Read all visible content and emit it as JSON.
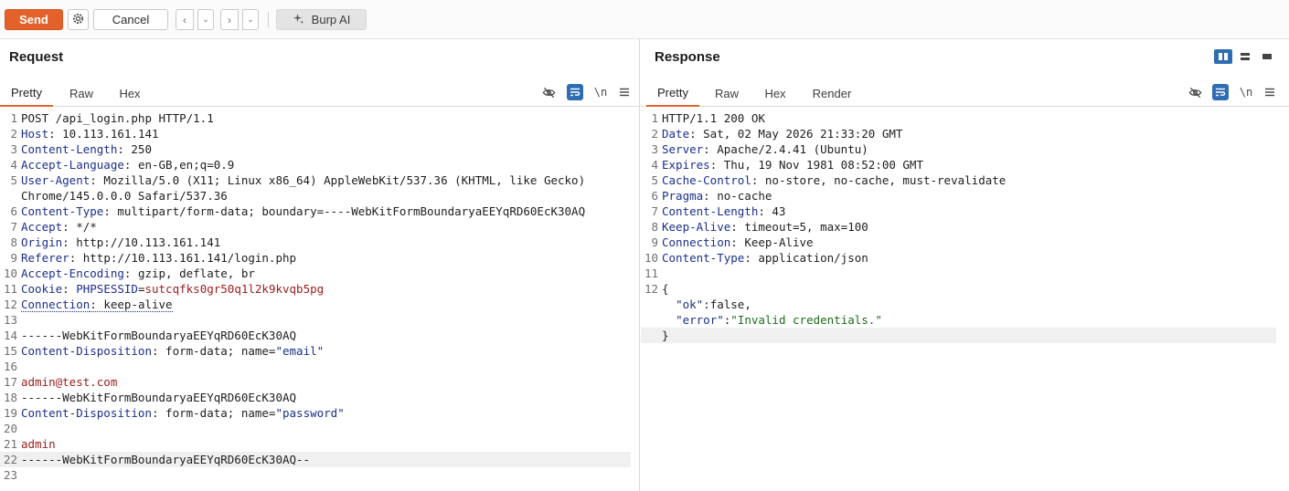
{
  "toolbar": {
    "send_label": "Send",
    "cancel_label": "Cancel",
    "burp_ai_label": "Burp AI",
    "back_glyph": "‹",
    "forward_glyph": "›",
    "dropdown_glyph": "⌄"
  },
  "request": {
    "title": "Request",
    "tabs": [
      "Pretty",
      "Raw",
      "Hex"
    ],
    "active_tab": "Pretty",
    "newline_label": "\\n",
    "lines": [
      {
        "n": "1",
        "parts": [
          {
            "t": "POST /api_login.php HTTP/1.1",
            "c": "hv"
          }
        ]
      },
      {
        "n": "2",
        "parts": [
          {
            "t": "Host",
            "c": "hk"
          },
          {
            "t": ": 10.113.161.141",
            "c": "hv"
          }
        ]
      },
      {
        "n": "3",
        "parts": [
          {
            "t": "Content-Length",
            "c": "hk"
          },
          {
            "t": ": 250",
            "c": "hv"
          }
        ]
      },
      {
        "n": "4",
        "parts": [
          {
            "t": "Accept-Language",
            "c": "hk"
          },
          {
            "t": ": en-GB,en;q=0.9",
            "c": "hv"
          }
        ]
      },
      {
        "n": "5",
        "parts": [
          {
            "t": "User-Agent",
            "c": "hk"
          },
          {
            "t": ": Mozilla/5.0 (X11; Linux x86_64) AppleWebKit/537.36 (KHTML, like Gecko)",
            "c": "hv"
          }
        ]
      },
      {
        "n": "",
        "parts": [
          {
            "t": "Chrome/145.0.0.0 Safari/537.36",
            "c": "hv"
          }
        ]
      },
      {
        "n": "6",
        "parts": [
          {
            "t": "Content-Type",
            "c": "hk"
          },
          {
            "t": ": multipart/form-data; boundary=----WebKitFormBoundaryaEEYqRD60EcK30AQ",
            "c": "hv"
          }
        ]
      },
      {
        "n": "7",
        "parts": [
          {
            "t": "Accept",
            "c": "hk"
          },
          {
            "t": ": */*",
            "c": "hv"
          }
        ]
      },
      {
        "n": "8",
        "parts": [
          {
            "t": "Origin",
            "c": "hk"
          },
          {
            "t": ": http://10.113.161.141",
            "c": "hv"
          }
        ]
      },
      {
        "n": "9",
        "parts": [
          {
            "t": "Referer",
            "c": "hk"
          },
          {
            "t": ": http://10.113.161.141/login.php",
            "c": "hv"
          }
        ]
      },
      {
        "n": "10",
        "parts": [
          {
            "t": "Accept-Encoding",
            "c": "hk"
          },
          {
            "t": ": gzip, deflate, br",
            "c": "hv"
          }
        ]
      },
      {
        "n": "11",
        "parts": [
          {
            "t": "Cookie",
            "c": "hk"
          },
          {
            "t": ": ",
            "c": "hv"
          },
          {
            "t": "PHPSESSID",
            "c": "hk"
          },
          {
            "t": "=",
            "c": "hv"
          },
          {
            "t": "sutcqfks0gr50q1l2k9kvqb5pg",
            "c": "red"
          }
        ]
      },
      {
        "n": "12",
        "parts": [
          {
            "t": "Connection",
            "c": "hk dotted"
          },
          {
            "t": ": keep-alive",
            "c": "hv dotted"
          }
        ]
      },
      {
        "n": "13",
        "parts": []
      },
      {
        "n": "14",
        "parts": [
          {
            "t": "------WebKitFormBoundaryaEEYqRD60EcK30AQ",
            "c": "hv"
          }
        ]
      },
      {
        "n": "15",
        "parts": [
          {
            "t": "Content-Disposition",
            "c": "hk"
          },
          {
            "t": ": form-data; name=",
            "c": "hv"
          },
          {
            "t": "\"email\"",
            "c": "str"
          }
        ]
      },
      {
        "n": "16",
        "parts": []
      },
      {
        "n": "17",
        "parts": [
          {
            "t": "admin@test.com",
            "c": "red"
          }
        ]
      },
      {
        "n": "18",
        "parts": [
          {
            "t": "------WebKitFormBoundaryaEEYqRD60EcK30AQ",
            "c": "hv"
          }
        ]
      },
      {
        "n": "19",
        "parts": [
          {
            "t": "Content-Disposition",
            "c": "hk"
          },
          {
            "t": ": form-data; name=",
            "c": "hv"
          },
          {
            "t": "\"password\"",
            "c": "str"
          }
        ]
      },
      {
        "n": "20",
        "parts": []
      },
      {
        "n": "21",
        "parts": [
          {
            "t": "admin",
            "c": "red"
          }
        ]
      },
      {
        "n": "22",
        "parts": [
          {
            "t": "------WebKitFormBoundaryaEEYqRD60EcK30AQ--",
            "c": "hv"
          }
        ],
        "hl": true
      },
      {
        "n": "23",
        "parts": []
      }
    ]
  },
  "response": {
    "title": "Response",
    "tabs": [
      "Pretty",
      "Raw",
      "Hex",
      "Render"
    ],
    "active_tab": "Pretty",
    "newline_label": "\\n",
    "lines": [
      {
        "n": "1",
        "parts": [
          {
            "t": "HTTP/1.1 200 OK",
            "c": "hv"
          }
        ]
      },
      {
        "n": "2",
        "parts": [
          {
            "t": "Date",
            "c": "hk"
          },
          {
            "t": ": Sat, 02 May 2026 21:33:20 GMT",
            "c": "hv"
          }
        ]
      },
      {
        "n": "3",
        "parts": [
          {
            "t": "Server",
            "c": "hk"
          },
          {
            "t": ": Apache/2.4.41 (Ubuntu)",
            "c": "hv"
          }
        ]
      },
      {
        "n": "4",
        "parts": [
          {
            "t": "Expires",
            "c": "hk"
          },
          {
            "t": ": Thu, 19 Nov 1981 08:52:00 GMT",
            "c": "hv"
          }
        ]
      },
      {
        "n": "5",
        "parts": [
          {
            "t": "Cache-Control",
            "c": "hk"
          },
          {
            "t": ": no-store, no-cache, must-revalidate",
            "c": "hv"
          }
        ]
      },
      {
        "n": "6",
        "parts": [
          {
            "t": "Pragma",
            "c": "hk"
          },
          {
            "t": ": no-cache",
            "c": "hv"
          }
        ]
      },
      {
        "n": "7",
        "parts": [
          {
            "t": "Content-Length",
            "c": "hk"
          },
          {
            "t": ": 43",
            "c": "hv"
          }
        ]
      },
      {
        "n": "8",
        "parts": [
          {
            "t": "Keep-Alive",
            "c": "hk"
          },
          {
            "t": ": timeout=5, max=100",
            "c": "hv"
          }
        ]
      },
      {
        "n": "9",
        "parts": [
          {
            "t": "Connection",
            "c": "hk"
          },
          {
            "t": ": Keep-Alive",
            "c": "hv"
          }
        ]
      },
      {
        "n": "10",
        "parts": [
          {
            "t": "Content-Type",
            "c": "hk"
          },
          {
            "t": ": application/json",
            "c": "hv"
          }
        ]
      },
      {
        "n": "11",
        "parts": []
      },
      {
        "n": "12",
        "parts": [
          {
            "t": "{",
            "c": "hv"
          }
        ]
      },
      {
        "n": "",
        "parts": [
          {
            "t": "  ",
            "c": "hv"
          },
          {
            "t": "\"ok\"",
            "c": "str"
          },
          {
            "t": ":false,",
            "c": "hv"
          }
        ]
      },
      {
        "n": "",
        "parts": [
          {
            "t": "  ",
            "c": "hv"
          },
          {
            "t": "\"error\"",
            "c": "str"
          },
          {
            "t": ":",
            "c": "hv"
          },
          {
            "t": "\"Invalid credentials.\"",
            "c": "green"
          }
        ]
      },
      {
        "n": "",
        "parts": [
          {
            "t": "}",
            "c": "hv"
          }
        ],
        "hl": true
      }
    ]
  },
  "colors": {
    "send": "#e3622c",
    "accent_blue": "#2f6db3",
    "header_key": "#1c2f8c",
    "value_red": "#9b1c1c",
    "json_string": "#1d6b1d"
  }
}
